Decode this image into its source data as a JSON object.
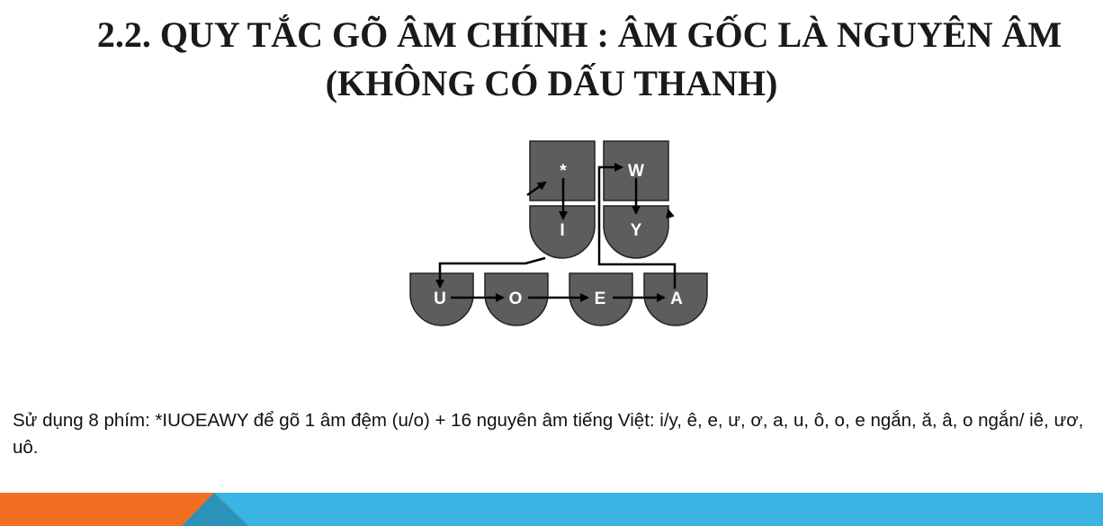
{
  "slide": {
    "title_line1": "2.2. QUY TẮC GÕ ÂM CHÍNH : ÂM GỐC LÀ NGUYÊN ÂM",
    "title_line2": "(KHÔNG CÓ DẤU THANH)",
    "description": "Sử dụng 8 phím: *IUOEAWY để gõ 1 âm đệm (u/o) + 16 nguyên âm tiếng Việt: i/y, ê, e, ư, ơ, a, u, ô, o, e ngắn, ă, â, o ngắn/ iê, ươ, uô."
  },
  "diagram": {
    "keys": {
      "star": "*",
      "w": "W",
      "i": "I",
      "y": "Y",
      "u": "U",
      "o": "O",
      "e": "E",
      "a": "A"
    },
    "key_color": "#5d5d5d",
    "arrow_color": "#000000"
  },
  "footer": {
    "orange": "#f26f21",
    "blue": "#3bb4e3",
    "dark_blue": "#2b93b8"
  }
}
